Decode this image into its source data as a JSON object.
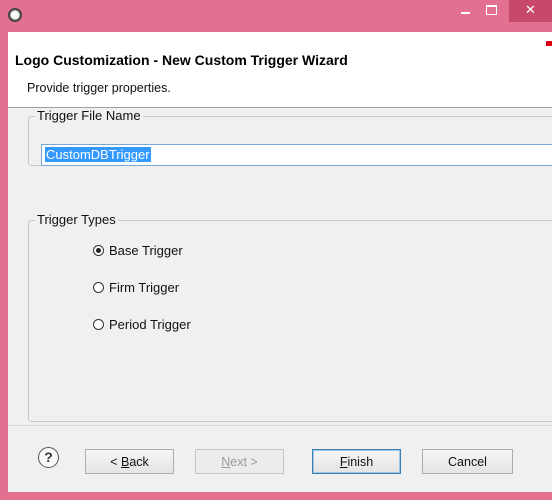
{
  "window": {
    "colors": {
      "frame": "#e36f91",
      "close": "#c74868",
      "selection": "#3399ff"
    }
  },
  "header": {
    "title": "Logo Customization - New Custom Trigger Wizard",
    "description": "Provide trigger properties."
  },
  "file_group": {
    "legend": "Trigger File Name",
    "value": "CustomDBTrigger"
  },
  "types_group": {
    "legend": "Trigger Types",
    "options": [
      {
        "label": "Base Trigger",
        "checked": true
      },
      {
        "label": "Firm Trigger",
        "checked": false
      },
      {
        "label": "Period Trigger",
        "checked": false
      }
    ]
  },
  "buttons": {
    "back": {
      "prefix": "< ",
      "mnemonic": "B",
      "rest": "ack"
    },
    "next": {
      "mnemonic": "N",
      "rest": "ext >"
    },
    "finish": {
      "mnemonic": "F",
      "rest": "inish"
    },
    "cancel": "Cancel"
  },
  "icons": {
    "app": "eclipse-app-icon",
    "help": "help-icon",
    "minimize": "minimize-icon",
    "maximize": "maximize-icon",
    "close": "close-icon"
  }
}
